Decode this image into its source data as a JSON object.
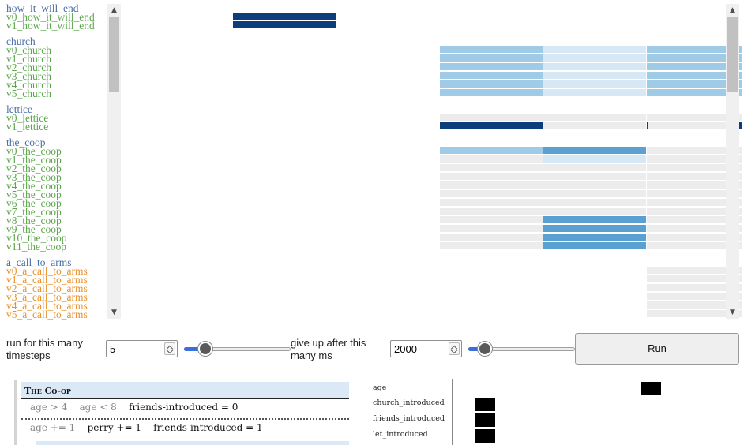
{
  "storylets": [
    {
      "group": "how_it_will_end",
      "versions": [
        "v0_how_it_will_end",
        "v1_how_it_will_end"
      ],
      "color": "green"
    },
    {
      "group": "church",
      "versions": [
        "v0_church",
        "v1_church",
        "v2_church",
        "v3_church",
        "v4_church",
        "v5_church"
      ],
      "color": "green"
    },
    {
      "group": "lettice",
      "versions": [
        "v0_lettice",
        "v1_lettice"
      ],
      "color": "green"
    },
    {
      "group": "the_coop",
      "versions": [
        "v0_the_coop",
        "v1_the_coop",
        "v2_the_coop",
        "v3_the_coop",
        "v4_the_coop",
        "v5_the_coop",
        "v6_the_coop",
        "v7_the_coop",
        "v8_the_coop",
        "v9_the_coop",
        "v10_the_coop",
        "v11_the_coop"
      ],
      "color": "green"
    },
    {
      "group": "a_call_to_arms",
      "versions": [
        "v0_a_call_to_arms",
        "v1_a_call_to_arms",
        "v2_a_call_to_arms",
        "v3_a_call_to_arms",
        "v4_a_call_to_arms",
        "v5_a_call_to_arms"
      ],
      "color": "orange"
    }
  ],
  "colors": {
    "group_label": "#4a6fa5",
    "green_label": "#5aa64a",
    "orange_label": "#e8922c",
    "dark": "#0d3d7a",
    "mid": "#5aa0d0",
    "light": "#9fcbe6",
    "pale": "#d6e8f5",
    "gray": "#ececec",
    "accent": "#3a6fd8"
  },
  "controls": {
    "timesteps_label": "run for this many timesteps",
    "timesteps_value": "5",
    "timesteps_slider_fraction": 0.15,
    "giveup_label": "give up after this many ms",
    "giveup_value": "2000",
    "giveup_slider_fraction": 0.1,
    "run_label": "Run"
  },
  "rule_card": {
    "title": "The Co-op",
    "rows": [
      {
        "conditions": [
          "age > 4",
          "age < 8"
        ],
        "effects": [
          "friends-introduced = 0"
        ]
      },
      {
        "conditions": [
          "age += 1"
        ],
        "effects": [
          "perry += 1",
          "friends-introduced = 1"
        ]
      }
    ]
  },
  "variables": [
    "age",
    "church_introduced",
    "friends_introduced",
    "let_introduced"
  ]
}
